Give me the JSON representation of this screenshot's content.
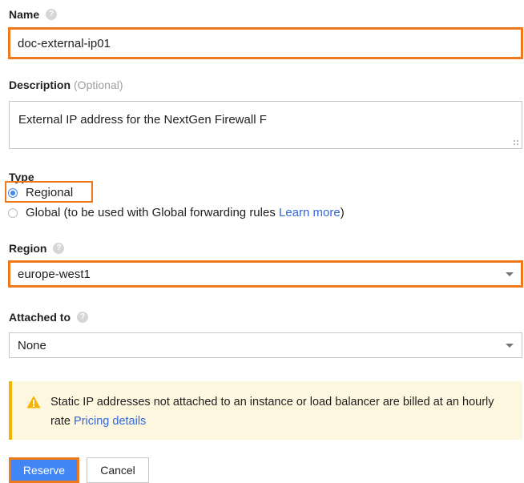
{
  "name_field": {
    "label": "Name",
    "value": "doc-external-ip01"
  },
  "description_field": {
    "label": "Description",
    "optional_hint": "(Optional)",
    "value": "External IP address for the NextGen Firewall F"
  },
  "type_field": {
    "label": "Type",
    "options": [
      {
        "label": "Regional",
        "selected": true
      },
      {
        "label": "Global (to be used with Global forwarding rules",
        "link": "Learn more",
        "suffix": ")",
        "selected": false
      }
    ]
  },
  "region_field": {
    "label": "Region",
    "value": "europe-west1"
  },
  "attached_field": {
    "label": "Attached to",
    "value": "None"
  },
  "warning": {
    "text": "Static IP addresses not attached to an instance or load balancer are billed at an hourly rate",
    "link": "Pricing details"
  },
  "buttons": {
    "reserve": "Reserve",
    "cancel": "Cancel"
  },
  "colors": {
    "highlight": "#ef7a1d",
    "primary": "#4285f4",
    "link": "#3367d6",
    "warning_bg": "#fef7e0",
    "warning_accent": "#f4b400"
  },
  "icons": {
    "help": "help-icon",
    "warning": "warning-triangle-icon",
    "dropdown": "chevron-down-icon"
  }
}
